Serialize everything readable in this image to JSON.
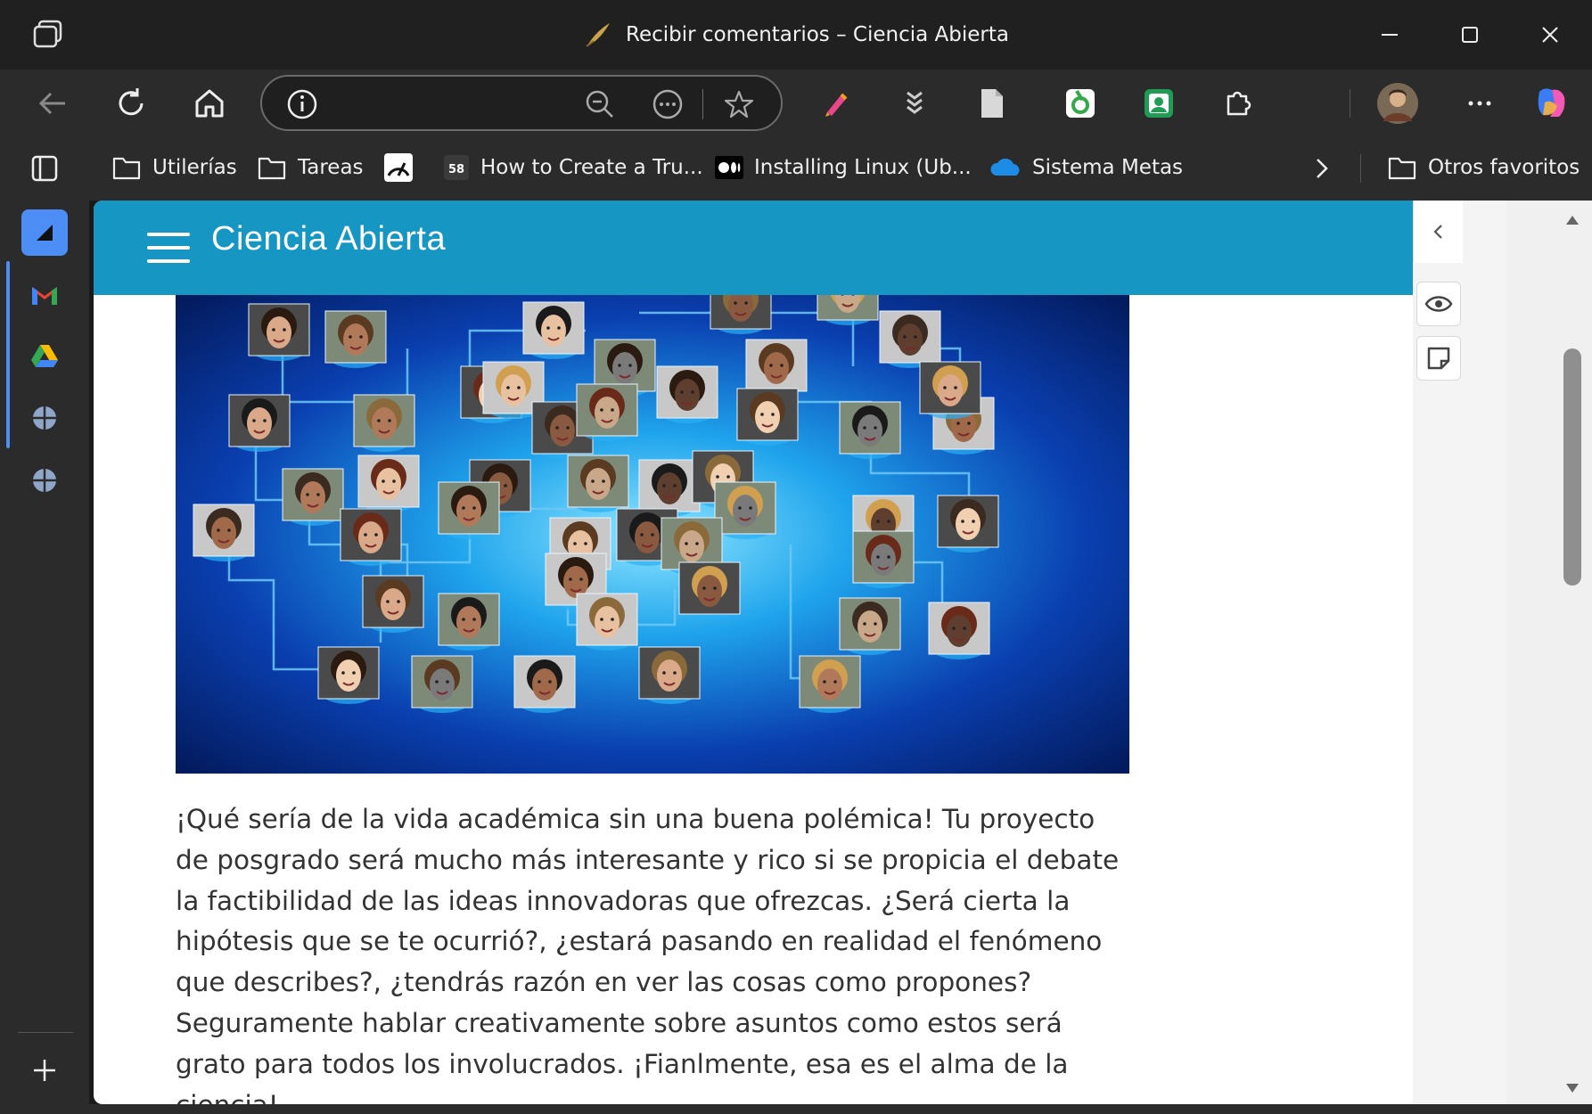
{
  "window": {
    "title": "Recibir comentarios – Ciencia Abierta"
  },
  "toolbar": {
    "address_value": "",
    "address_placeholder": ""
  },
  "bookmarks": [
    {
      "label": "Utilerías",
      "icon": "folder-icon"
    },
    {
      "label": "Tareas",
      "icon": "folder-icon"
    },
    {
      "label": "",
      "icon": "speedometer-icon"
    },
    {
      "label": "How to Create a Tru...",
      "icon": "badge-58-icon",
      "badge": "58"
    },
    {
      "label": "Installing Linux (Ub...",
      "icon": "medium-icon"
    },
    {
      "label": "Sistema Metas",
      "icon": "cloud-icon"
    }
  ],
  "bookmarks_other": "Otros favoritos",
  "site": {
    "title": "Ciencia Abierta"
  },
  "article": {
    "paragraph": "¡Qué sería de la vida académica sin una buena polémica! Tu proyecto de posgrado será mucho más interesante y rico si se propicia el debate la factibilidad de las ideas innovadoras que ofrezcas. ¿Será cierta la hipótesis que se te ocurrió?, ¿estará pasando en realidad el fenómeno que describes?, ¿tendrás razón en ver las cosas como propones? Seguramente hablar creativamente sobre asuntos como estos será grato para todos los involucrados. ¡Fianlmente, esa es el alma de la ciencia!."
  },
  "colors": {
    "header": "#1596c3",
    "chrome": "#2b2b2b",
    "titlebar": "#202020",
    "text": "#333333"
  }
}
